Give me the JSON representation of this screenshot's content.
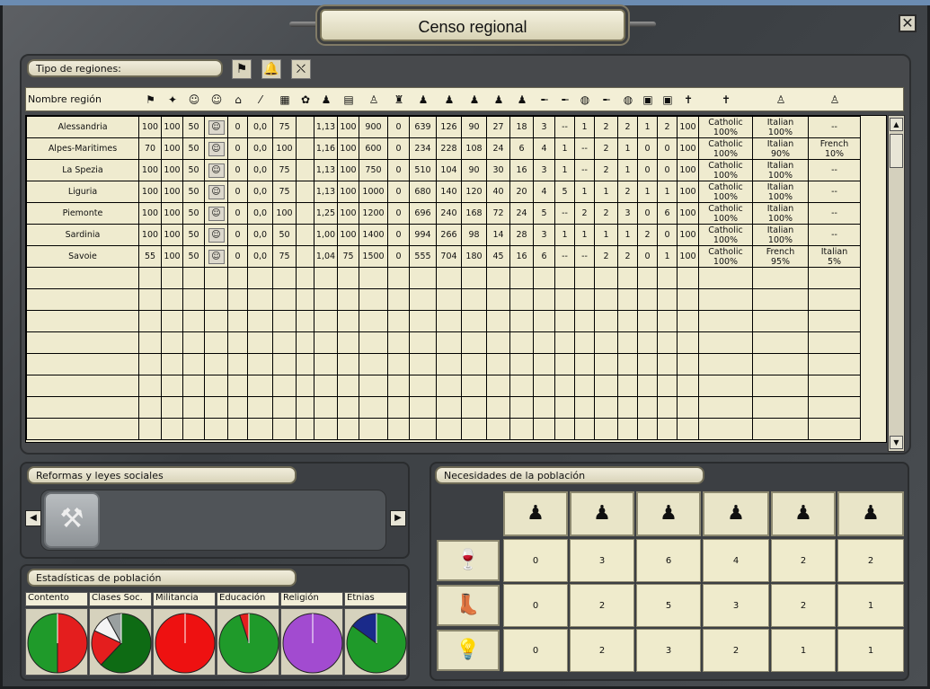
{
  "window": {
    "title": "Censo regional",
    "close_glyph": "✕"
  },
  "filter": {
    "label": "Tipo de regiones:",
    "buttons": [
      "flag-icon",
      "bell-icon",
      "barrier-icon"
    ]
  },
  "header": {
    "name_label": "Nombre región",
    "icons": [
      "flag-icon",
      "party-icon",
      "masks-icon",
      "masks-icon",
      "factory-icon",
      "rifle-icon",
      "map-icon",
      "crowd-icon",
      "people-icon",
      "book-icon",
      "workers-icon",
      "soldier-icon",
      "pop-icon",
      "pop-icon",
      "pop-icon",
      "pop-icon",
      "pop-icon",
      "gun-icon",
      "gun-icon",
      "food-icon",
      "gun-icon",
      "food-icon",
      "goods-icon",
      "goods-icon",
      "religion-icon",
      "religion-icon",
      "ethnicity-icon",
      "ethnicity-icon"
    ]
  },
  "rows": [
    [
      "Alessandria",
      "100",
      "100",
      "50",
      "☺",
      "0",
      "0,0",
      "75",
      "",
      "1,13",
      "100",
      "900",
      "0",
      "639",
      "126",
      "90",
      "27",
      "18",
      "3",
      "--",
      "1",
      "2",
      "2",
      "1",
      "2",
      "100",
      "Catholic\n100%",
      "Italian\n100%",
      "--"
    ],
    [
      "Alpes-Maritimes",
      "70",
      "100",
      "50",
      "☺",
      "0",
      "0,0",
      "100",
      "",
      "1,16",
      "100",
      "600",
      "0",
      "234",
      "228",
      "108",
      "24",
      "6",
      "4",
      "1",
      "--",
      "2",
      "1",
      "0",
      "0",
      "100",
      "Catholic\n100%",
      "Italian\n90%",
      "French\n10%"
    ],
    [
      "La Spezia",
      "100",
      "100",
      "50",
      "☺",
      "0",
      "0,0",
      "75",
      "",
      "1,13",
      "100",
      "750",
      "0",
      "510",
      "104",
      "90",
      "30",
      "16",
      "3",
      "1",
      "--",
      "2",
      "1",
      "0",
      "0",
      "100",
      "Catholic\n100%",
      "Italian\n100%",
      "--"
    ],
    [
      "Liguria",
      "100",
      "100",
      "50",
      "☺",
      "0",
      "0,0",
      "75",
      "",
      "1,13",
      "100",
      "1000",
      "0",
      "680",
      "140",
      "120",
      "40",
      "20",
      "4",
      "5",
      "1",
      "1",
      "2",
      "1",
      "1",
      "100",
      "Catholic\n100%",
      "Italian\n100%",
      "--"
    ],
    [
      "Piemonte",
      "100",
      "100",
      "50",
      "☺",
      "0",
      "0,0",
      "100",
      "",
      "1,25",
      "100",
      "1200",
      "0",
      "696",
      "240",
      "168",
      "72",
      "24",
      "5",
      "--",
      "2",
      "2",
      "3",
      "0",
      "6",
      "100",
      "Catholic\n100%",
      "Italian\n100%",
      "--"
    ],
    [
      "Sardinia",
      "100",
      "100",
      "50",
      "☺",
      "0",
      "0,0",
      "50",
      "",
      "1,00",
      "100",
      "1400",
      "0",
      "994",
      "266",
      "98",
      "14",
      "28",
      "3",
      "1",
      "1",
      "1",
      "1",
      "2",
      "0",
      "100",
      "Catholic\n100%",
      "Italian\n100%",
      "--"
    ],
    [
      "Savoie",
      "55",
      "100",
      "50",
      "☺",
      "0",
      "0,0",
      "75",
      "",
      "1,04",
      "75",
      "1500",
      "0",
      "555",
      "704",
      "180",
      "45",
      "16",
      "6",
      "--",
      "--",
      "2",
      "2",
      "0",
      "1",
      "100",
      "Catholic\n100%",
      "French\n95%",
      "Italian\n5%"
    ]
  ],
  "reforms": {
    "label": "Reformas y leyes sociales",
    "left_arrow": "◀",
    "right_arrow": "▶",
    "icon": "worker-cart-icon"
  },
  "stats": {
    "label": "Estadísticas de población",
    "tabs": [
      "Contento",
      "Clases Soc.",
      "Militancia",
      "Educación",
      "Religión",
      "Etnias"
    ],
    "pies": [
      [
        {
          "v": 0.5,
          "c": "#e41e1e"
        },
        {
          "v": 0.5,
          "c": "#1f9a2a"
        }
      ],
      [
        {
          "v": 0.62,
          "c": "#0e6b14"
        },
        {
          "v": 0.2,
          "c": "#e41e1e"
        },
        {
          "v": 0.1,
          "c": "#f4f4f4"
        },
        {
          "v": 0.08,
          "c": "#9aa0a0"
        }
      ],
      [
        {
          "v": 1.0,
          "c": "#ee1111"
        }
      ],
      [
        {
          "v": 0.95,
          "c": "#1f9a2a"
        },
        {
          "v": 0.05,
          "c": "#e41e1e"
        }
      ],
      [
        {
          "v": 1.0,
          "c": "#a24bd0"
        }
      ],
      [
        {
          "v": 0.85,
          "c": "#1f9a2a"
        },
        {
          "v": 0.15,
          "c": "#1a2a8a"
        }
      ]
    ]
  },
  "needs": {
    "label": "Necesidades de la población",
    "columns": [
      "pop-icon",
      "pop-icon",
      "pop-icon",
      "pop-icon",
      "pop-icon",
      "pop-icon"
    ],
    "rows": [
      {
        "icon": "wine-icon",
        "values": [
          "0",
          "3",
          "6",
          "4",
          "2",
          "2"
        ]
      },
      {
        "icon": "boots-icon",
        "values": [
          "0",
          "2",
          "5",
          "3",
          "2",
          "1"
        ]
      },
      {
        "icon": "luxury-icon",
        "values": [
          "0",
          "2",
          "3",
          "2",
          "1",
          "1"
        ]
      }
    ]
  }
}
